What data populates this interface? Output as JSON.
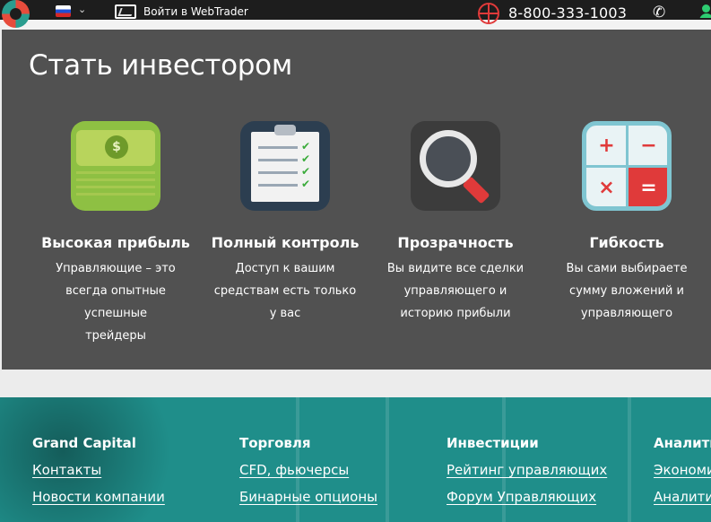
{
  "topbar": {
    "logo": "grand-capital-logo",
    "language_flag": "russia-flag",
    "webtrader_label": "Войти в WebTrader",
    "phone": "8-800-333-1003"
  },
  "invest": {
    "title": "Стать инвестором",
    "features": [
      {
        "icon": "money-stack-icon",
        "title": "Высокая прибыль",
        "text": "Управляющие – это всегда опытные успешные трейдеры"
      },
      {
        "icon": "clipboard-checklist-icon",
        "title": "Полный контроль",
        "text": "Доступ к вашим средствам есть только у вас"
      },
      {
        "icon": "magnifier-icon",
        "title": "Прозрачность",
        "text": "Вы видите все сделки управляющего и историю прибыли"
      },
      {
        "icon": "calculator-icon",
        "title": "Гибкость",
        "text": "Вы сами выбираете сумму вложений и управляющего"
      }
    ]
  },
  "footer": {
    "columns": [
      {
        "title": "Grand Capital",
        "links": [
          "Контакты",
          "Новости компании"
        ]
      },
      {
        "title": "Торговля",
        "links": [
          "CFD, фьючерсы",
          "Бинарные опционы"
        ]
      },
      {
        "title": "Инвестиции",
        "links": [
          "Рейтинг управляющих",
          "Форум Управляющих"
        ]
      },
      {
        "title": "Аналити",
        "links": [
          "Экономи",
          "Аналити"
        ]
      }
    ]
  },
  "colors": {
    "topbar": "#1d1d1d",
    "panel": "#515151",
    "footer": "#1f8e8a",
    "accent_red": "#e03a3a",
    "accent_green": "#2ecc71"
  }
}
